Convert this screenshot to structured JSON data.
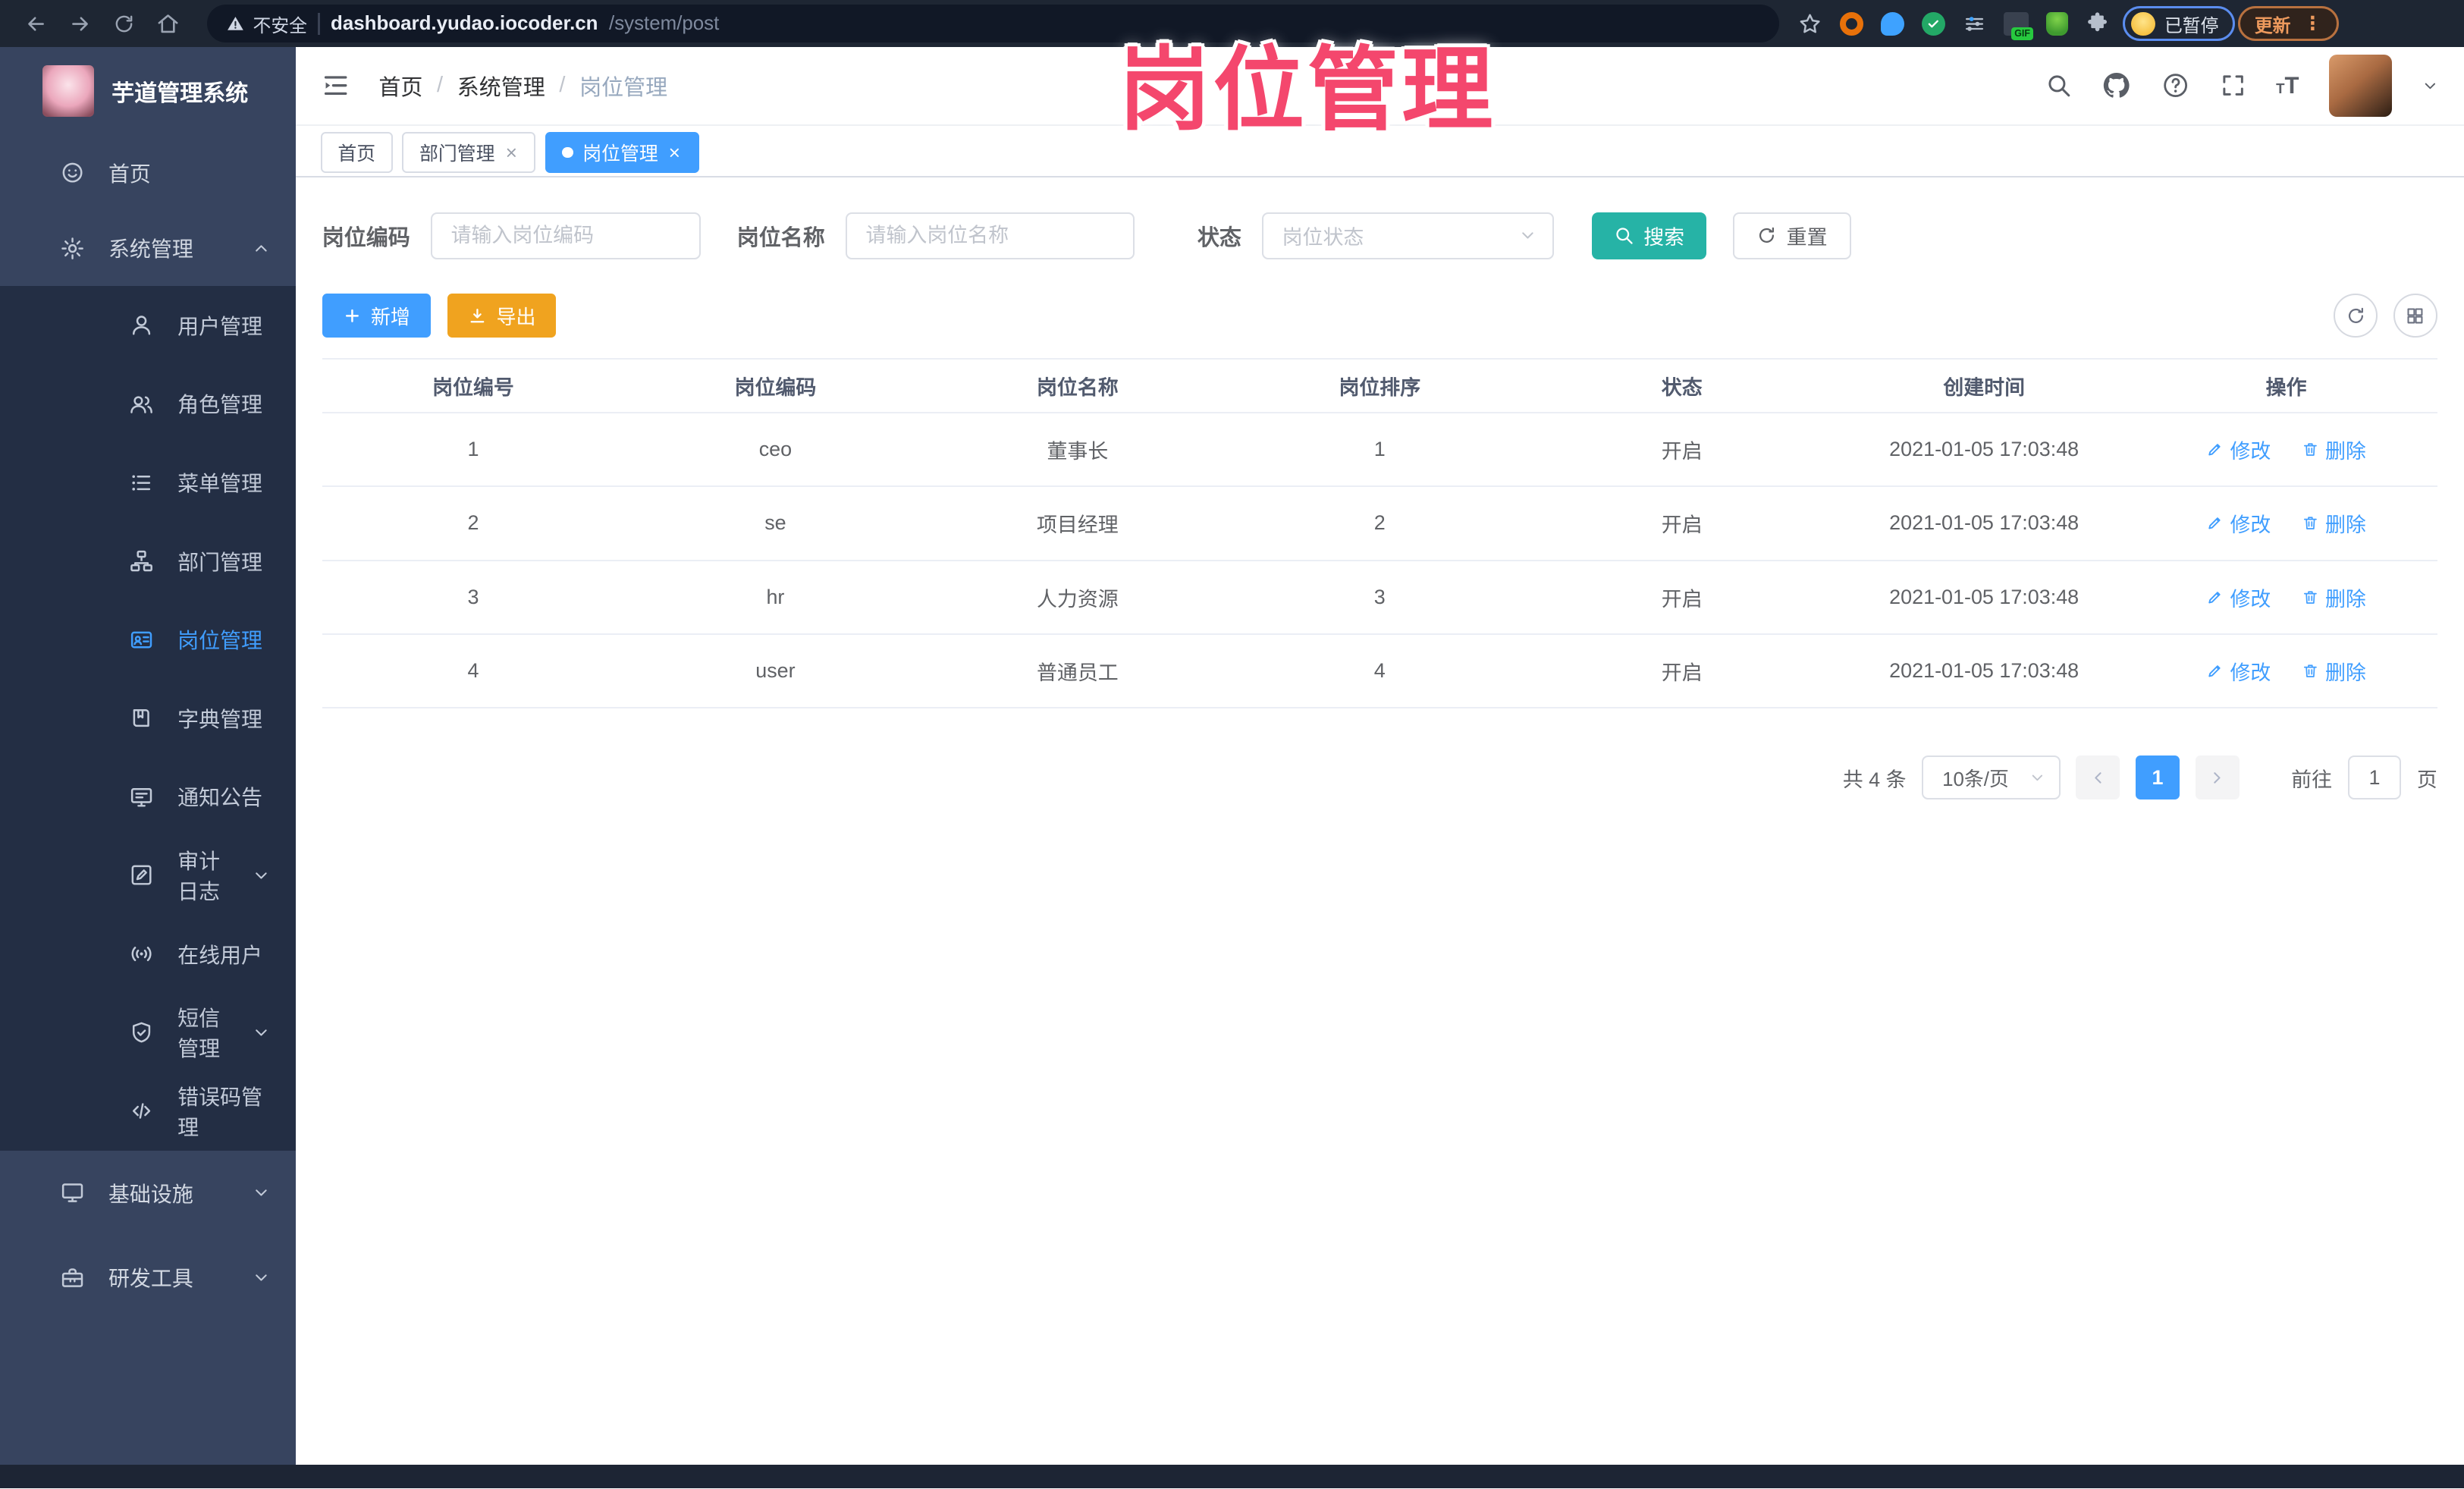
{
  "browser": {
    "security_label": "不安全",
    "url_host": "dashboard.yudao.iocoder.cn",
    "url_path": "/system/post",
    "gif_badge": "GIF",
    "paused_badge": "已暂停",
    "update_label": "更新"
  },
  "overlay_title": "岗位管理",
  "sidebar": {
    "logo_title": "芋道管理系统",
    "items": [
      {
        "label": "首页"
      },
      {
        "label": "系统管理"
      },
      {
        "label": "用户管理"
      },
      {
        "label": "角色管理"
      },
      {
        "label": "菜单管理"
      },
      {
        "label": "部门管理"
      },
      {
        "label": "岗位管理"
      },
      {
        "label": "字典管理"
      },
      {
        "label": "通知公告"
      },
      {
        "label": "审计日志"
      },
      {
        "label": "在线用户"
      },
      {
        "label": "短信管理"
      },
      {
        "label": "错误码管理"
      },
      {
        "label": "基础设施"
      },
      {
        "label": "研发工具"
      }
    ]
  },
  "breadcrumb": {
    "items": [
      "首页",
      "系统管理",
      "岗位管理"
    ],
    "separator": "/"
  },
  "tabs": [
    {
      "label": "首页"
    },
    {
      "label": "部门管理"
    },
    {
      "label": "岗位管理"
    }
  ],
  "filters": {
    "code_label": "岗位编码",
    "code_placeholder": "请输入岗位编码",
    "name_label": "岗位名称",
    "name_placeholder": "请输入岗位名称",
    "status_label": "状态",
    "status_placeholder": "岗位状态",
    "search_label": "搜索",
    "reset_label": "重置"
  },
  "toolbar": {
    "add_label": "新增",
    "export_label": "导出"
  },
  "table": {
    "columns": [
      "岗位编号",
      "岗位编码",
      "岗位名称",
      "岗位排序",
      "状态",
      "创建时间",
      "操作"
    ],
    "rows": [
      {
        "id": "1",
        "code": "ceo",
        "name": "董事长",
        "sort": "1",
        "status": "开启",
        "created": "2021-01-05 17:03:48"
      },
      {
        "id": "2",
        "code": "se",
        "name": "项目经理",
        "sort": "2",
        "status": "开启",
        "created": "2021-01-05 17:03:48"
      },
      {
        "id": "3",
        "code": "hr",
        "name": "人力资源",
        "sort": "3",
        "status": "开启",
        "created": "2021-01-05 17:03:48"
      },
      {
        "id": "4",
        "code": "user",
        "name": "普通员工",
        "sort": "4",
        "status": "开启",
        "created": "2021-01-05 17:03:48"
      }
    ],
    "edit_label": "修改",
    "delete_label": "删除"
  },
  "pagination": {
    "total": "共 4 条",
    "page_size": "10条/页",
    "current_page": "1",
    "goto_label": "前往",
    "goto_value": "1",
    "page_unit": "页"
  },
  "colors": {
    "accent": "#409eff",
    "search_button": "#26b3a6",
    "export_button": "#f0a31f",
    "overlay_pink": "#f4476d"
  }
}
